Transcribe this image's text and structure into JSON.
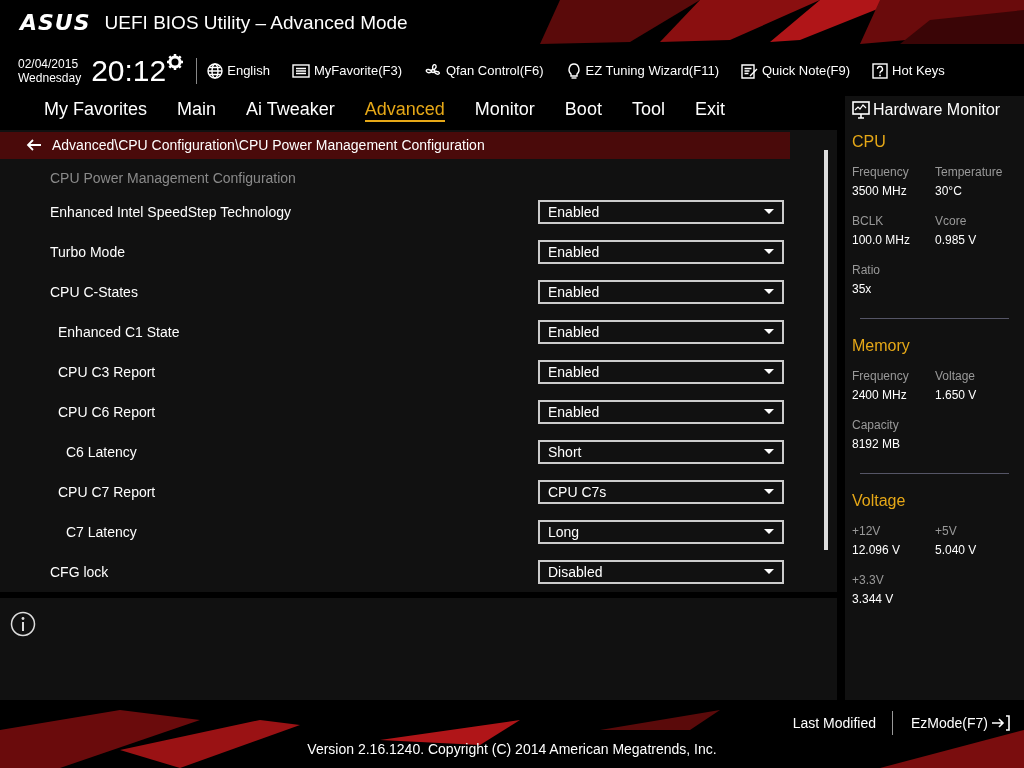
{
  "header": {
    "logo": "ASUS",
    "title": "UEFI BIOS Utility – Advanced Mode"
  },
  "toolbar": {
    "date": "02/04/2015",
    "day": "Wednesday",
    "time": "20:12",
    "items": [
      {
        "kind": "globe",
        "label": "English"
      },
      {
        "kind": "list",
        "label": "MyFavorite(F3)"
      },
      {
        "kind": "fan",
        "label": "Qfan Control(F6)"
      },
      {
        "kind": "bulb",
        "label": "EZ Tuning Wizard(F11)"
      },
      {
        "kind": "note",
        "label": "Quick Note(F9)"
      },
      {
        "kind": "help",
        "label": "Hot Keys"
      }
    ]
  },
  "tabs": [
    {
      "label": "My Favorites",
      "selected": false
    },
    {
      "label": "Main",
      "selected": false
    },
    {
      "label": "Ai Tweaker",
      "selected": false
    },
    {
      "label": "Advanced",
      "selected": true
    },
    {
      "label": "Monitor",
      "selected": false
    },
    {
      "label": "Boot",
      "selected": false
    },
    {
      "label": "Tool",
      "selected": false
    },
    {
      "label": "Exit",
      "selected": false
    }
  ],
  "breadcrumb": "Advanced\\CPU Configuration\\CPU Power Management Configuration",
  "section_title": "CPU Power Management Configuration",
  "settings": [
    {
      "label": "Enhanced Intel SpeedStep Technology",
      "value": "Enabled"
    },
    {
      "label": "Turbo Mode",
      "value": "Enabled"
    },
    {
      "label": "CPU C-States",
      "value": "Enabled",
      "children": [
        {
          "label": "Enhanced C1 State",
          "value": "Enabled"
        },
        {
          "label": "CPU C3 Report",
          "value": "Enabled"
        },
        {
          "label": "CPU C6 Report",
          "value": "Enabled",
          "children": [
            {
              "label": "C6 Latency",
              "value": "Short"
            }
          ]
        },
        {
          "label": "CPU C7 Report",
          "value": "CPU C7s",
          "children": [
            {
              "label": "C7 Latency",
              "value": "Long"
            }
          ]
        }
      ]
    },
    {
      "label": "CFG lock",
      "value": "Disabled"
    }
  ],
  "hardware_monitor": {
    "title": "Hardware Monitor",
    "sections": [
      {
        "title": "CPU",
        "fields": [
          {
            "label": "Frequency",
            "value": "3500 MHz"
          },
          {
            "label": "Temperature",
            "value": "30°C"
          },
          {
            "label": "BCLK",
            "value": "100.0 MHz"
          },
          {
            "label": "Vcore",
            "value": "0.985 V"
          },
          {
            "label": "Ratio",
            "value": "35x"
          }
        ]
      },
      {
        "title": "Memory",
        "fields": [
          {
            "label": "Frequency",
            "value": "2400 MHz"
          },
          {
            "label": "Voltage",
            "value": "1.650 V"
          },
          {
            "label": "Capacity",
            "value": "8192 MB"
          }
        ]
      },
      {
        "title": "Voltage",
        "fields": [
          {
            "label": "+12V",
            "value": "12.096 V"
          },
          {
            "label": "+5V",
            "value": "5.040 V"
          },
          {
            "label": "+3.3V",
            "value": "3.344 V"
          }
        ]
      }
    ]
  },
  "footer": {
    "last_modified": "Last Modified",
    "ez_mode": "EzMode(F7)",
    "version": "Version 2.16.1240. Copyright (C) 2014 American Megatrends, Inc."
  }
}
